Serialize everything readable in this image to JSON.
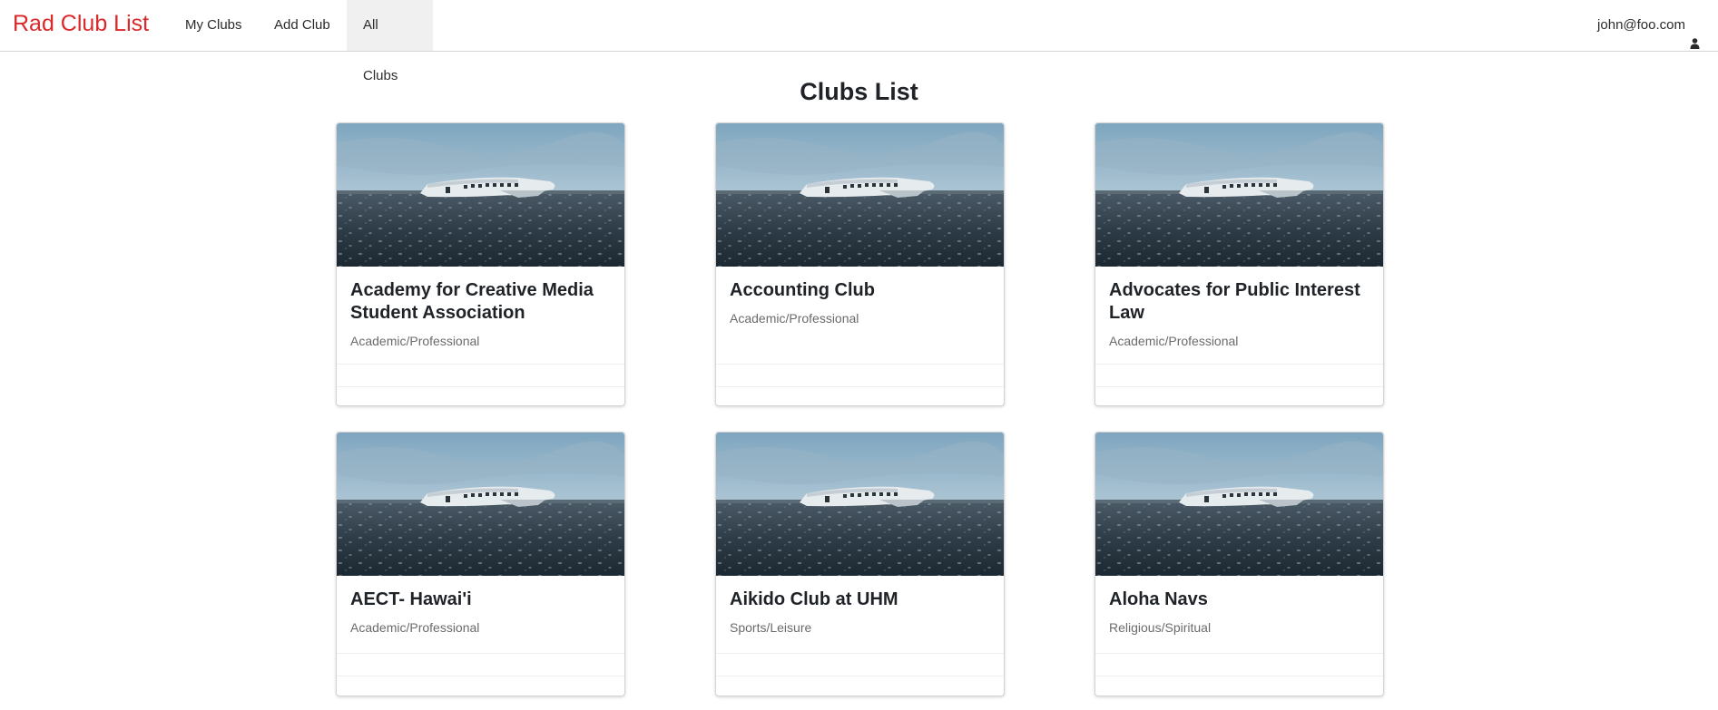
{
  "navbar": {
    "brand": "Rad Club List",
    "items": [
      {
        "label": "My Clubs"
      },
      {
        "label": "Add Club"
      },
      {
        "label": "All Clubs",
        "active": true
      }
    ],
    "user_email": "john@foo.com",
    "user_icon": "user-icon"
  },
  "page": {
    "title": "Clubs List"
  },
  "clubs": [
    {
      "name": "Academy for Creative Media Student Association",
      "category": "Academic/Professional",
      "image": "crashed-plane-photo"
    },
    {
      "name": "Accounting Club",
      "category": "Academic/Professional",
      "image": "crashed-plane-photo"
    },
    {
      "name": "Advocates for Public Interest Law",
      "category": "Academic/Professional",
      "image": "crashed-plane-photo"
    },
    {
      "name": "AECT- Hawai'i",
      "category": "Academic/Professional",
      "image": "crashed-plane-photo"
    },
    {
      "name": "Aikido Club at UHM",
      "category": "Sports/Leisure",
      "image": "crashed-plane-photo"
    },
    {
      "name": "Aloha Navs",
      "category": "Religious/Spiritual",
      "image": "crashed-plane-photo"
    }
  ],
  "colors": {
    "brand": "#db2828",
    "active_nav_bg": "#f0f0f0",
    "meta_text": "#6b6b6b"
  }
}
